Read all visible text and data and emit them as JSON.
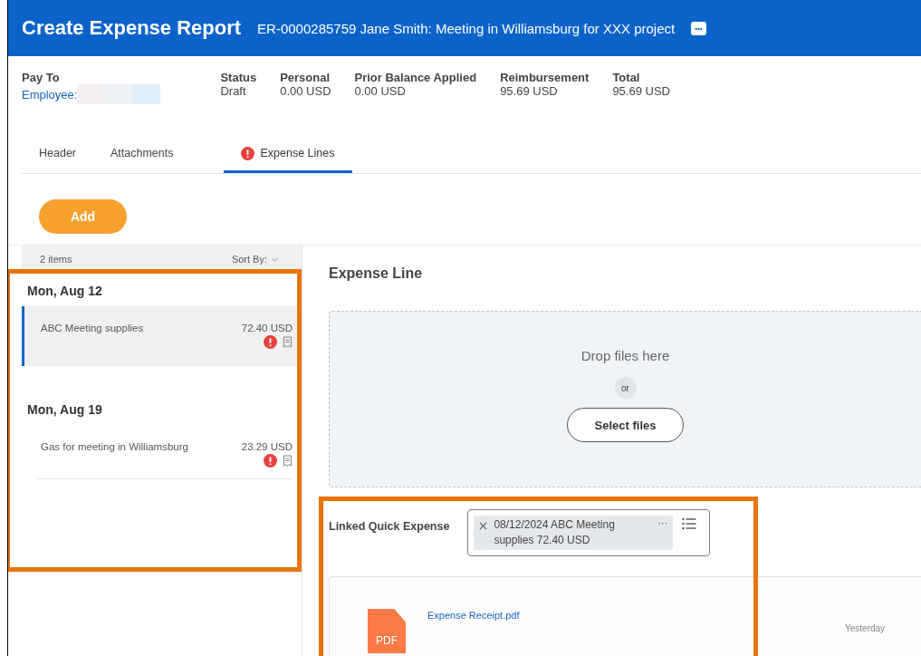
{
  "header": {
    "title": "Create Expense Report",
    "subtitle": "ER-0000285759 Jane Smith: Meeting in Williamsburg for XXX project",
    "more_button": "•••"
  },
  "summary": {
    "pay_to": {
      "label": "Pay To",
      "value": "Employee:"
    },
    "fields": [
      {
        "label": "Status",
        "value": "Draft"
      },
      {
        "label": "Personal",
        "value": "0.00 USD"
      },
      {
        "label": "Prior Balance Applied",
        "value": "0.00 USD"
      },
      {
        "label": "Reimbursement",
        "value": "95.69 USD"
      },
      {
        "label": "Total",
        "value": "95.69 USD"
      }
    ]
  },
  "tabs": [
    {
      "label": "Header",
      "selected": false,
      "error": false
    },
    {
      "label": "Attachments",
      "selected": false,
      "error": false
    },
    {
      "label": "Expense Lines",
      "selected": true,
      "error": true
    }
  ],
  "add_button": "Add",
  "list": {
    "count": "2 items",
    "sort_label": "Sort By:",
    "groups": [
      {
        "date": "Mon, Aug 12",
        "items": [
          {
            "name": "ABC Meeting supplies",
            "amount": "72.40 USD",
            "selected": true,
            "error": true
          }
        ]
      },
      {
        "date": "Mon, Aug 19",
        "items": [
          {
            "name": "Gas for meeting in Williamsburg",
            "amount": "23.29 USD",
            "selected": false,
            "error": true
          }
        ]
      }
    ]
  },
  "detail": {
    "title": "Expense Line",
    "drop_text": "Drop files here",
    "or": "or",
    "select_button": "Select files",
    "linked_label": "Linked Quick Expense",
    "linked_value": "08/12/2024 ABC Meeting supplies 72.40 USD",
    "linked_more": "···",
    "attachment": {
      "file_type": "PDF",
      "name": "Expense Receipt.pdf",
      "time": "Yesterday"
    }
  }
}
